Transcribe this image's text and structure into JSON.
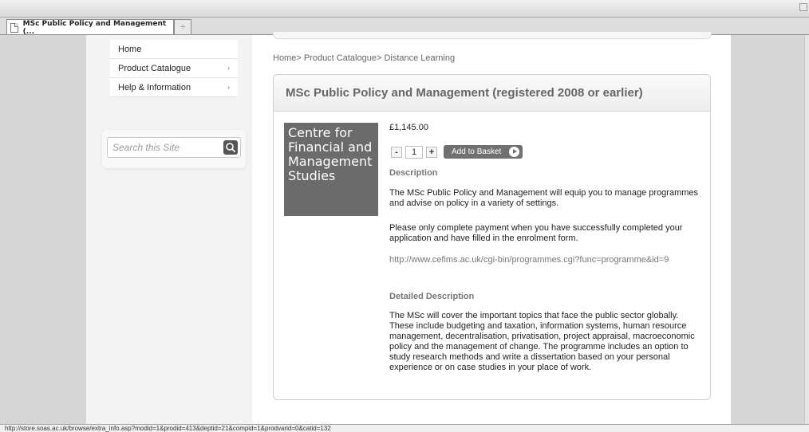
{
  "browser": {
    "tab_title": "MSc Public Policy and Management (...",
    "new_tab_label": "÷",
    "status_url": "http://store.soas.ac.uk/browse/extra_info.asp?modid=1&prodid=413&deptid=21&compid=1&prodvarid=0&catid=132"
  },
  "sidebar": {
    "nav": [
      {
        "label": "Home",
        "has_submenu": false
      },
      {
        "label": "Product Catalogue",
        "has_submenu": true
      },
      {
        "label": "Help & Information",
        "has_submenu": true
      }
    ],
    "submenu_arrow": "›",
    "search_placeholder": "Search this Site"
  },
  "breadcrumb": {
    "items": [
      "Home",
      "Product Catalogue",
      "Distance Learning"
    ],
    "separator": "> "
  },
  "product": {
    "title": "MSc Public Policy and Management (registered 2008 or earlier)",
    "logo_lines": [
      "Centre for",
      "Financial and",
      "Management",
      "Studies"
    ],
    "price": "£1,145.00",
    "qty_minus": "-",
    "qty_value": "1",
    "qty_plus": "+",
    "add_label": "Add to Basket",
    "description_heading": "Description",
    "description_p1": "The MSc Public Policy and Management will equip you to manage programmes and advise on policy in a variety of settings.",
    "description_p2": "Please only complete payment when you have successfully completed your application and have filled in the enrolment form.",
    "link": "http://www.cefims.ac.uk/cgi-bin/programmes.cgi?func=programme&id=9",
    "detailed_heading": "Detailed Description",
    "detailed_text": "The MSc will cover the important topics that face the public sector globally. These include budgeting and taxation, information systems, human resource management, decentralisation, privatisation, project appraisal, macroeconomic policy and the management of change. The programme includes an option to study research methods and write a dissertation based on your personal experience or on case studies in your place of work."
  },
  "colors": {
    "logo_bg": "#6b6b6b",
    "button_bg": "#707070"
  }
}
